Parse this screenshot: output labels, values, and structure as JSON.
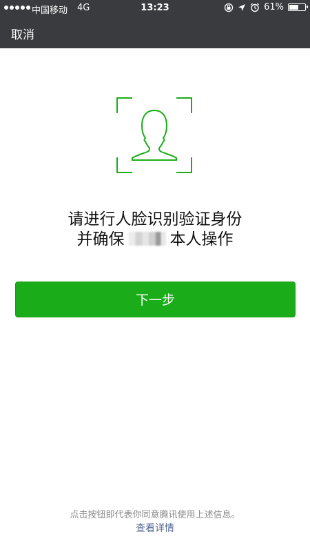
{
  "status_bar": {
    "carrier": "中国移动",
    "network": "4G",
    "time": "13:23",
    "battery_percent_label": "61%",
    "battery_level": 0.61,
    "icons": [
      "orientation-lock-icon",
      "location-arrow-icon",
      "alarm-clock-icon",
      "battery-icon"
    ]
  },
  "nav": {
    "cancel_label": "取消"
  },
  "face_frame": {
    "icon": "face-outline-icon",
    "color": "#1aad19"
  },
  "instructions": {
    "line1": "请进行人脸识别验证身份",
    "line2_prefix": "并确保",
    "line2_suffix": "本人操作"
  },
  "next_button": {
    "label": "下一步",
    "color": "#1aad19"
  },
  "footer": {
    "notice": "点击按钮即代表你同意腾讯使用上述信息。",
    "details_link": "查看详情",
    "link_color": "#576b95"
  },
  "colors": {
    "header_bg": "#3a3b3f",
    "accent": "#1aad19"
  }
}
